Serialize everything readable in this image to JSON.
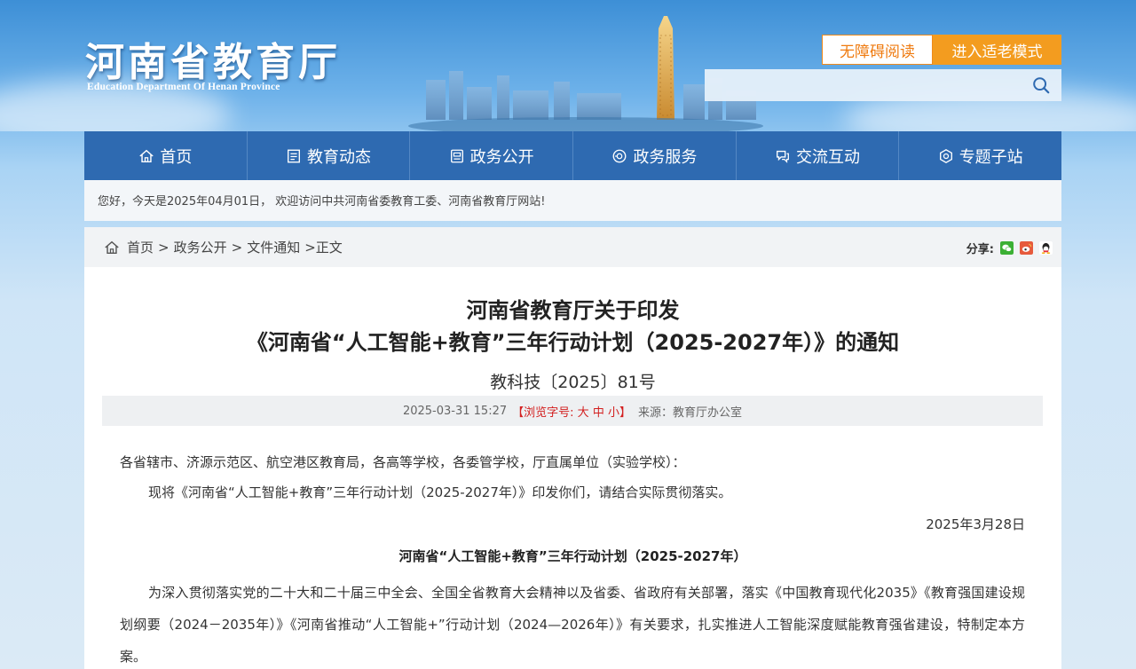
{
  "header": {
    "logo_cn": "河南省教育厅",
    "logo_en": "Education Department Of Henan Province",
    "accessible_read": "无障碍阅读",
    "elder_mode": "进入适老模式",
    "search_placeholder": ""
  },
  "nav": {
    "items": [
      {
        "label": "首页",
        "icon": "home-icon"
      },
      {
        "label": "教育动态",
        "icon": "news-icon"
      },
      {
        "label": "政务公开",
        "icon": "document-icon"
      },
      {
        "label": "政务服务",
        "icon": "service-icon"
      },
      {
        "label": "交流互动",
        "icon": "chat-icon"
      },
      {
        "label": "专题子站",
        "icon": "subsite-icon"
      }
    ]
  },
  "welcome": "您好，今天是2025年04月01日， 欢迎访问中共河南省委教育工委、河南省教育厅网站!",
  "breadcrumb": {
    "items": [
      "首页",
      "政务公开",
      "文件通知"
    ],
    "current": "正文"
  },
  "share": {
    "label": "分享:",
    "icons": [
      "wechat-icon",
      "weibo-icon",
      "qq-icon"
    ]
  },
  "article": {
    "title_line1": "河南省教育厅关于印发",
    "title_line2": "《河南省“人工智能+教育”三年行动计划（2025-2027年）》的通知",
    "doc_no": "教科技〔2025〕81号",
    "datetime": "2025-03-31 15:27",
    "font_size_label": "【浏览字号:",
    "font_large": "大",
    "font_medium": "中",
    "font_small": "小",
    "font_size_end": "】",
    "source": "来源：教育厅办公室",
    "recipients": "各省辖市、济源示范区、航空港区教育局，各高等学校，各委管学校，厅直属单位（实验学校）：",
    "intro": "现将《河南省“人工智能+教育”三年行动计划（2025-2027年）》印发你们，请结合实际贯彻落实。",
    "date": "2025年3月28日",
    "plan_title": "河南省“人工智能+教育”三年行动计划（2025-2027年）",
    "paragraph1": "为深入贯彻落实党的二十大和二十届三中全会、全国全省教育大会精神以及省委、省政府有关部署，落实《中国教育现代化2035》《教育强国建设规划纲要（2024－2035年）》《河南省推动“人工智能+”行动计划（2024—2026年）》有关要求，扎实推进人工智能深度赋能教育强省建设，特制定本方案。"
  },
  "colors": {
    "nav_bg": "#2e6ab1",
    "accent_orange": "#f39c1f",
    "font_size_red": "#d32020"
  }
}
